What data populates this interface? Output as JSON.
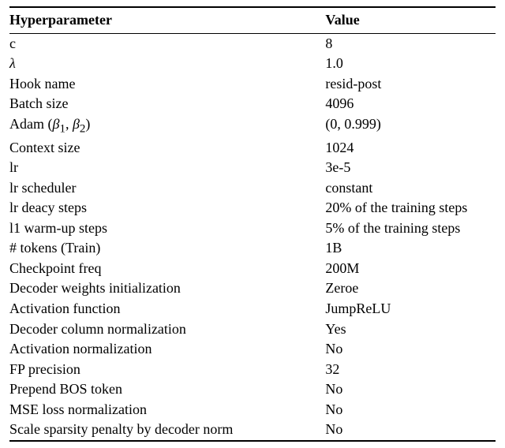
{
  "headers": {
    "hyperparameter": "Hyperparameter",
    "value": "Value"
  },
  "rows": [
    {
      "param_pre": "c",
      "param_sub": "",
      "param_post": "",
      "value": "8"
    },
    {
      "param_pre": "",
      "param_sub": "",
      "param_post": "",
      "param_sym": "λ",
      "value": "1.0"
    },
    {
      "param_pre": "Hook name",
      "value": "resid-post"
    },
    {
      "param_pre": "Batch size",
      "value": "4096"
    },
    {
      "param_pre": "Adam (",
      "param_sym1": "β",
      "param_sub1": "1",
      "param_sep": ", ",
      "param_sym2": "β",
      "param_sub2": "2",
      "param_post": ")",
      "value": "(0, 0.999)"
    },
    {
      "param_pre": "Context size",
      "value": "1024"
    },
    {
      "param_pre": "lr",
      "value": "3e-5"
    },
    {
      "param_pre": "lr scheduler",
      "value": "constant"
    },
    {
      "param_pre": "lr deacy steps",
      "value": "20% of the training steps"
    },
    {
      "param_pre": "l1 warm-up steps",
      "value": "5% of the training steps"
    },
    {
      "param_pre": "# tokens (Train)",
      "value": "1B"
    },
    {
      "param_pre": "Checkpoint freq",
      "value": "200M"
    },
    {
      "param_pre": "Decoder weights initialization",
      "value": "Zeroe"
    },
    {
      "param_pre": "Activation function",
      "value": "JumpReLU"
    },
    {
      "param_pre": "Decoder column normalization",
      "value": "Yes"
    },
    {
      "param_pre": "Activation normalization",
      "value": "No"
    },
    {
      "param_pre": "FP precision",
      "value": "32"
    },
    {
      "param_pre": "Prepend BOS token",
      "value": "No"
    },
    {
      "param_pre": "MSE loss normalization",
      "value": "No"
    },
    {
      "param_pre": "Scale sparsity penalty by decoder norm",
      "value": "No"
    }
  ]
}
